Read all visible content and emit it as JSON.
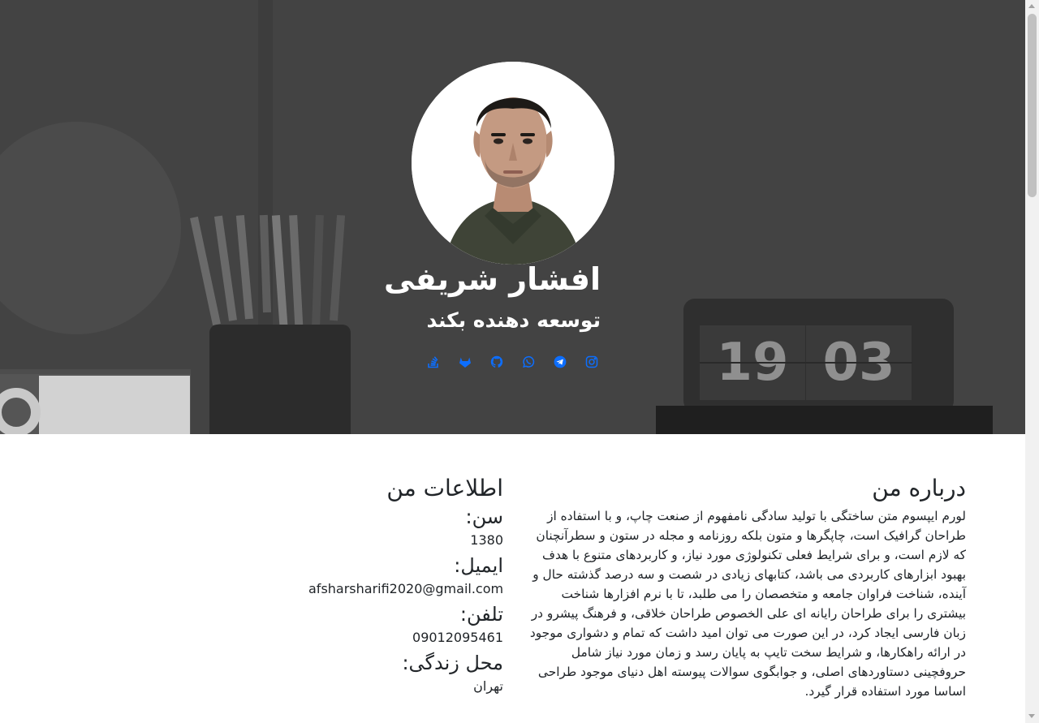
{
  "profile": {
    "name": "افشار شریفی",
    "role": "توسعه دهنده بکند"
  },
  "hero_clock": {
    "hours": "19",
    "minutes": "03"
  },
  "socials": [
    {
      "icon": "stackoverflow-icon"
    },
    {
      "icon": "gitlab-icon"
    },
    {
      "icon": "github-icon"
    },
    {
      "icon": "whatsapp-icon"
    },
    {
      "icon": "telegram-icon"
    },
    {
      "icon": "instagram-icon"
    }
  ],
  "about": {
    "title": "درباره من",
    "text": "لورم ایپسوم متن ساختگی با تولید سادگی نامفهوم از صنعت چاپ، و با استفاده از طراحان گرافیک است، چاپگرها و متون بلکه روزنامه و مجله در ستون و سطرآنچنان که لازم است، و برای شرایط فعلی تکنولوژی مورد نیاز، و کاربردهای متنوع با هدف بهبود ابزارهای کاربردی می باشد، کتابهای زیادی در شصت و سه درصد گذشته حال و آینده، شناخت فراوان جامعه و متخصصان را می طلبد، تا با نرم افزارها شناخت بیشتری را برای طراحان رایانه ای علی الخصوص طراحان خلاقی، و فرهنگ پیشرو در زبان فارسی ایجاد کرد، در این صورت می توان امید داشت که تمام و دشواری موجود در ارائه راهکارها، و شرایط سخت تایپ به پایان رسد و زمان مورد نیاز شامل حروفچینی دستاوردهای اصلی، و جوابگوی سوالات پیوسته اهل دنیای موجود طراحی اساسا مورد استفاده قرار گیرد."
  },
  "info": {
    "title": "اطلاعات من",
    "age_label": "سن:",
    "age_value": "1380",
    "email_label": "ایمیل:",
    "email_value": "afsharsharifi2020@gmail.com",
    "phone_label": "تلفن:",
    "phone_value": "09012095461",
    "location_label": "محل زندگی:",
    "location_value": "تهران"
  },
  "colors": {
    "hero_bg": "#434343",
    "accent": "#0d6efd",
    "text": "#212529"
  }
}
